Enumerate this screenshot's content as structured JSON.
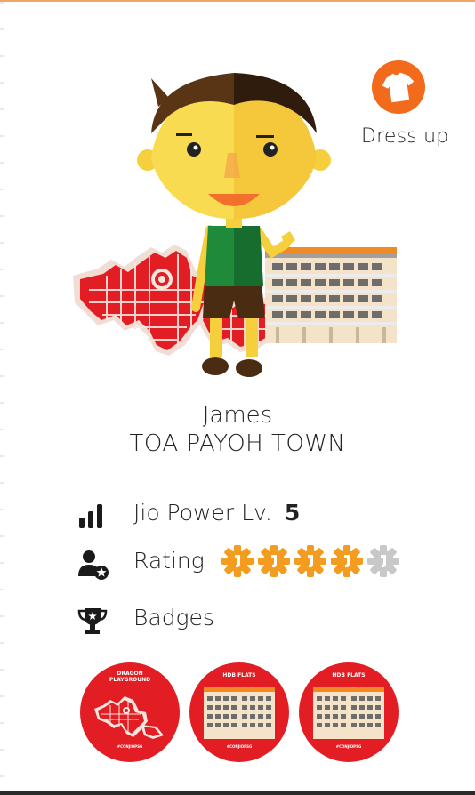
{
  "dress_up": {
    "label": "Dress up",
    "icon": "tshirt-icon"
  },
  "profile": {
    "name": "James",
    "town": "TOA PAYOH TOWN"
  },
  "stats": {
    "power": {
      "label": "Jio Power Lv.",
      "value": "5",
      "icon": "bar-signal-icon"
    },
    "rating": {
      "label": "Rating",
      "icon": "user-star-icon",
      "filled": 4,
      "max": 5
    },
    "badges": {
      "label": "Badges",
      "icon": "trophy-icon"
    }
  },
  "badge_list": [
    {
      "title_line1": "DRAGON",
      "title_line2": "PLAYGROUND",
      "foot": "#CONJIOPSG"
    },
    {
      "title_line1": "HDB FLATS",
      "title_line2": "",
      "foot": "#CONJIOPSG"
    },
    {
      "title_line1": "HDB FLATS",
      "title_line2": "",
      "foot": "#CONJIOPSG"
    }
  ],
  "colors": {
    "accent": "#f26a1b",
    "badge_red": "#e31d24",
    "star_filled": "#f39c1f",
    "star_empty": "#c8c8c8"
  }
}
